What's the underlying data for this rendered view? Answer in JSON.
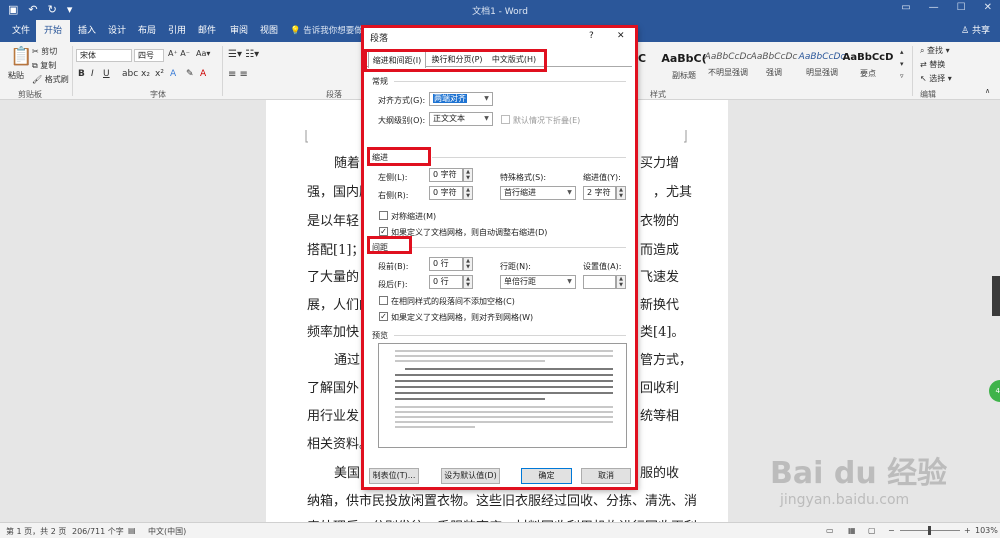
{
  "window": {
    "title": "文档1 - Word",
    "min_icon": "minimize-icon",
    "max_icon": "maximize-icon",
    "close_icon": "close-icon",
    "qat": [
      "save-icon",
      "undo-icon",
      "redo-icon",
      "customize-icon"
    ]
  },
  "tabs": [
    "文件",
    "开始",
    "插入",
    "设计",
    "布局",
    "引用",
    "邮件",
    "审阅",
    "视图"
  ],
  "tell_me": "告诉我你想要做什么",
  "share": "共享",
  "ribbon": {
    "paste": "粘贴",
    "cut": "剪切",
    "copy": "复制",
    "format_painter": "格式刷",
    "clipboard_label": "剪贴板",
    "font_name": "宋体",
    "font_size": "四号",
    "font_label": "字体",
    "paragraph_label": "段落",
    "styles_label": "样式",
    "editing_label": "编辑",
    "find": "查找",
    "replace": "替换",
    "select": "选择",
    "styles": [
      {
        "sample": "AaBbC(",
        "name": "副标题"
      },
      {
        "sample": "AaBbCcDc",
        "name": "不明显强调"
      },
      {
        "sample": "AaBbCcDc",
        "name": "强调"
      },
      {
        "sample": "AaBbCcDc",
        "name": "明显强调"
      },
      {
        "sample": "AaBbCcD",
        "name": "要点"
      }
    ],
    "style_partial": "C"
  },
  "document": {
    "lines": [
      "随着",
      "强，国内服",
      "是以年轻",
      "搭配[1]；另",
      "了大量的",
      "展，人们的",
      "频率加快",
      "通过",
      "了解国外",
      "用行业发",
      "相关资料。",
      "美国",
      "纳箱，供市民投放闲置衣物。这些旧衣服经过回收、分拣、清洗、消",
      "毒处理后，分别发往二手服装商店，材料回收利用机构进行回收再利"
    ],
    "right_fragments": [
      "买力增",
      "，尤其",
      "衣物的",
      "而造成",
      "飞速发",
      "新换代",
      "类[4]。",
      "管方式，",
      "回收利",
      "统等相",
      "服的收"
    ]
  },
  "dialog": {
    "title": "段落",
    "help": "?",
    "close": "✕",
    "tabs": [
      "缩进和间距(I)",
      "换行和分页(P)",
      "中文版式(H)"
    ],
    "general_header": "常规",
    "alignment_label": "对齐方式(G):",
    "alignment_value": "两端对齐",
    "outline_label": "大纲级别(O):",
    "outline_value": "正文文本",
    "collapsed_label": "默认情况下折叠(E)",
    "indent_header": "缩进",
    "left_label": "左侧(L):",
    "left_value": "0 字符",
    "right_label": "右侧(R):",
    "right_value": "0 字符",
    "special_label": "特殊格式(S):",
    "special_value": "首行缩进",
    "indent_by_label": "缩进值(Y):",
    "indent_by_value": "2 字符",
    "mirror_label": "对称缩进(M)",
    "auto_right_label": "如果定义了文档网格，则自动调整右缩进(D)",
    "spacing_header": "间距",
    "before_label": "段前(B):",
    "before_value": "0 行",
    "after_label": "段后(F):",
    "after_value": "0 行",
    "line_spacing_label": "行距(N):",
    "line_spacing_value": "单倍行距",
    "at_label": "设置值(A):",
    "at_value": "",
    "no_space_label": "在相同样式的段落间不添加空格(C)",
    "snap_grid_label": "如果定义了文档网格，则对齐到网格(W)",
    "preview_header": "预览",
    "tabs_button": "制表位(T)...",
    "default_button": "设为默认值(D)",
    "ok_button": "确定",
    "cancel_button": "取消",
    "checks": {
      "mirror": false,
      "auto_right": true,
      "no_space": false,
      "snap_grid": true,
      "collapsed": false
    }
  },
  "status": {
    "page": "第 1 页，共 2 页",
    "words": "206/711 个字",
    "language": "中文(中国)",
    "zoom": "103%"
  },
  "watermark": {
    "brand": "Bai du 经验",
    "url": "jingyan.baidu.com"
  },
  "colors": {
    "accent": "#2b579a",
    "highlight": "#e0101f",
    "selection": "#1e73d2"
  }
}
